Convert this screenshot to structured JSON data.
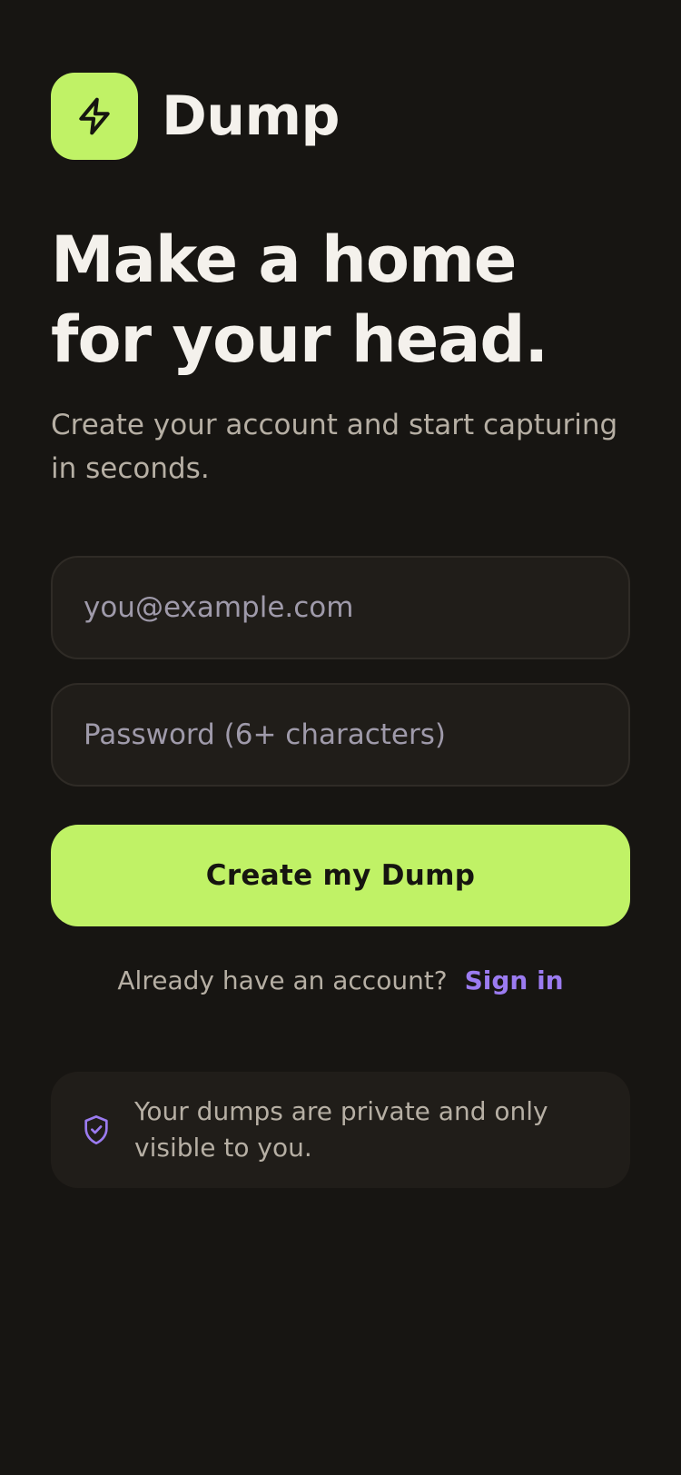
{
  "brand": {
    "name": "Dump",
    "logo_icon": "lightning-bolt-icon"
  },
  "hero": {
    "headline": "Make a home for your head.",
    "subhead": "Create your account and start capturing in seconds."
  },
  "form": {
    "email": {
      "value": "",
      "placeholder": "you@example.com"
    },
    "password": {
      "value": "",
      "placeholder": "Password (6+ characters)"
    },
    "submit_label": "Create my Dump"
  },
  "signin": {
    "prompt": "Already have an account?",
    "link_label": "Sign in"
  },
  "privacy": {
    "icon": "shield-check-icon",
    "text": "Your dumps are private and only visible to you."
  },
  "colors": {
    "background": "#171512",
    "accent": "#c0f266",
    "link": "#9b7bf0",
    "surface": "#201d19"
  }
}
